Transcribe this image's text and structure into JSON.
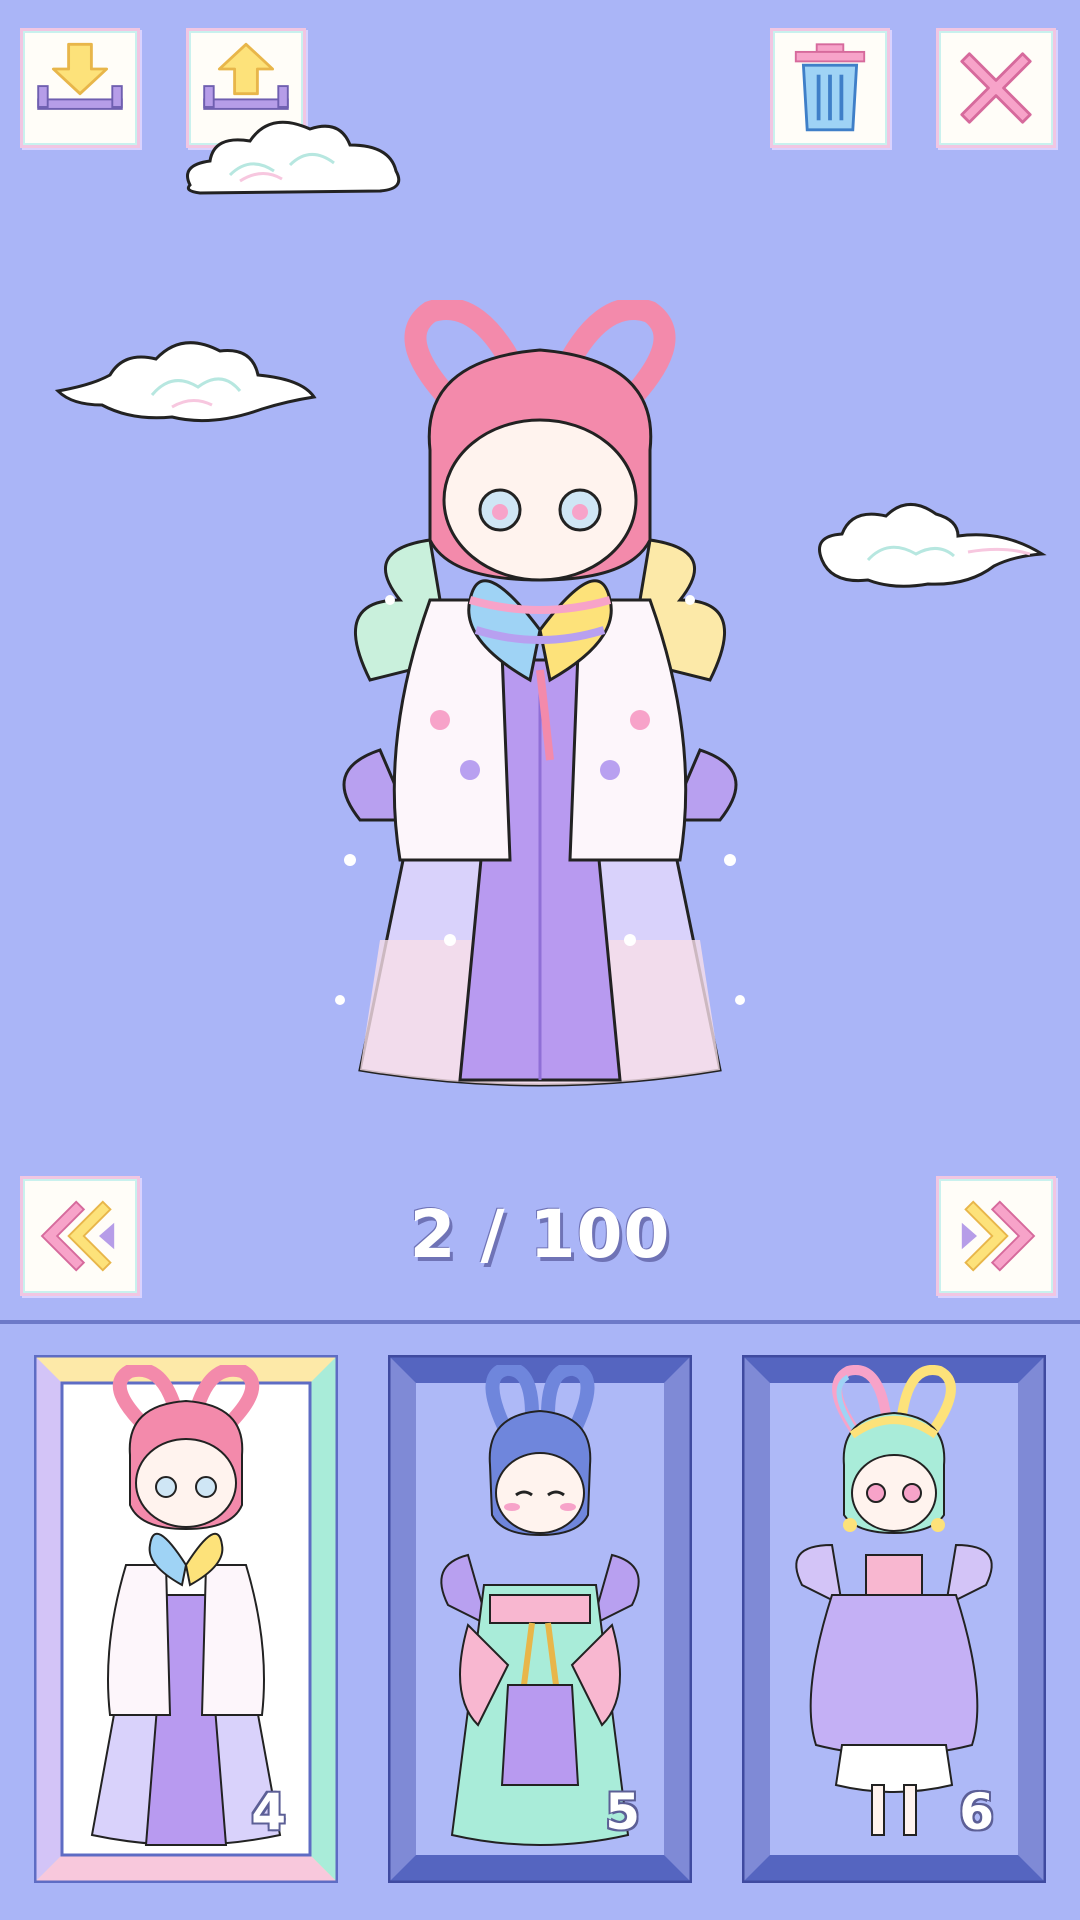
{
  "toolbar": {
    "download_icon": "download-icon",
    "upload_icon": "upload-icon",
    "trash_icon": "trash-icon",
    "close_icon": "close-icon"
  },
  "navigation": {
    "prev_icon": "double-chevron-left-icon",
    "next_icon": "double-chevron-right-icon",
    "counter": "2 / 100"
  },
  "slots": [
    {
      "number": "4",
      "selected": true
    },
    {
      "number": "5",
      "selected": false
    },
    {
      "number": "6",
      "selected": false
    }
  ],
  "colors": {
    "background": "#aab5f7",
    "accent_pink": "#f7a3c9",
    "accent_purple": "#b8a0f0",
    "accent_yellow": "#fde27a",
    "accent_blue": "#8fb8f0"
  }
}
